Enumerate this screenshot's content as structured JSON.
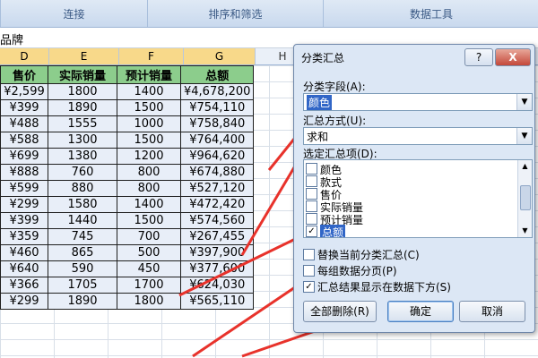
{
  "ribbon": {
    "groups": [
      "连接",
      "排序和筛选",
      "数据工具"
    ]
  },
  "formula_bar": {
    "text": "品牌"
  },
  "columns": [
    {
      "letter": "D"
    },
    {
      "letter": "E"
    },
    {
      "letter": "F"
    },
    {
      "letter": "G"
    },
    {
      "letter": "H"
    }
  ],
  "table": {
    "headers": [
      "售价",
      "实际销量",
      "预计销量",
      "总额"
    ],
    "rows": [
      [
        "¥2,599",
        "1800",
        "1400",
        "¥4,678,200"
      ],
      [
        "¥399",
        "1890",
        "1500",
        "¥754,110"
      ],
      [
        "¥488",
        "1555",
        "1000",
        "¥758,840"
      ],
      [
        "¥588",
        "1300",
        "1500",
        "¥764,400"
      ],
      [
        "¥699",
        "1380",
        "1200",
        "¥964,620"
      ],
      [
        "¥888",
        "760",
        "800",
        "¥674,880"
      ],
      [
        "¥599",
        "880",
        "800",
        "¥527,120"
      ],
      [
        "¥299",
        "1580",
        "1400",
        "¥472,420"
      ],
      [
        "¥399",
        "1440",
        "1500",
        "¥574,560"
      ],
      [
        "¥359",
        "745",
        "700",
        "¥267,455"
      ],
      [
        "¥460",
        "865",
        "500",
        "¥397,900"
      ],
      [
        "¥640",
        "590",
        "450",
        "¥377,600"
      ],
      [
        "¥366",
        "1705",
        "1700",
        "¥624,030"
      ],
      [
        "¥299",
        "1890",
        "1800",
        "¥565,110"
      ]
    ]
  },
  "dialog": {
    "title": "分类汇总",
    "help_label": "?",
    "close_label": "X",
    "field_label": "分类字段(A):",
    "field_value": "颜色",
    "func_label": "汇总方式(U):",
    "func_value": "求和",
    "items_label": "选定汇总项(D):",
    "items": [
      {
        "label": "颜色",
        "checked": false
      },
      {
        "label": "款式",
        "checked": false
      },
      {
        "label": "售价",
        "checked": false
      },
      {
        "label": "实际销量",
        "checked": false
      },
      {
        "label": "预计销量",
        "checked": false
      },
      {
        "label": "总额",
        "checked": true,
        "selected": true
      }
    ],
    "options": [
      {
        "label": "替换当前分类汇总(C)",
        "checked": false
      },
      {
        "label": "每组数据分页(P)",
        "checked": false
      },
      {
        "label": "汇总结果显示在数据下方(S)",
        "checked": true
      }
    ],
    "remove_all": "全部删除(R)",
    "ok": "确定",
    "cancel": "取消"
  },
  "annotation_color": "#e8322b"
}
